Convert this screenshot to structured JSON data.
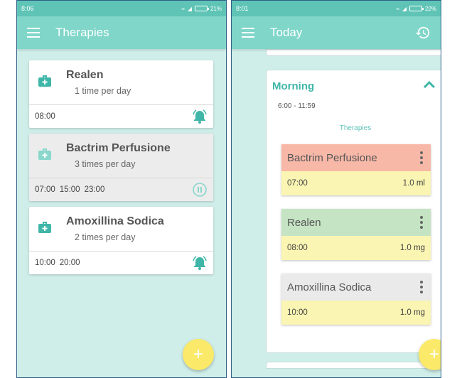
{
  "left": {
    "status_time": "8:06",
    "status_battery": "21%",
    "title": "Therapies",
    "therapies": [
      {
        "name": "Realen",
        "frequency": "1 time per day",
        "times": [
          "08:00"
        ],
        "status": "alarm"
      },
      {
        "name": "Bactrim Perfusione",
        "frequency": "3 times per day",
        "times": [
          "07:00",
          "15:00",
          "23:00"
        ],
        "status": "paused"
      },
      {
        "name": "Amoxillina Sodica",
        "frequency": "2 times per day",
        "times": [
          "10:00",
          "20:00"
        ],
        "status": "alarm"
      }
    ],
    "fab_label": "+"
  },
  "right": {
    "status_time": "8:01",
    "status_battery": "22%",
    "title": "Today",
    "section": {
      "title": "Morning",
      "range": "6:00 - 11:59",
      "subtitle": "Therapies"
    },
    "doses": [
      {
        "name": "Bactrim Perfusione",
        "time": "07:00",
        "amount": "1.0 ml",
        "header_color": "#f7b8a8"
      },
      {
        "name": "Realen",
        "time": "08:00",
        "amount": "1.0 mg",
        "header_color": "#c5e4c3"
      },
      {
        "name": "Amoxillina Sodica",
        "time": "10:00",
        "amount": "1.0 mg",
        "header_color": "#eaeaea"
      }
    ],
    "fab_label": "+"
  },
  "colors": {
    "toolbar": "#7fd6c9",
    "statusbar": "#5fc4b6",
    "accent": "#3fb6a8",
    "fab": "#fbe96a",
    "dose_body": "#fbf5b3"
  }
}
